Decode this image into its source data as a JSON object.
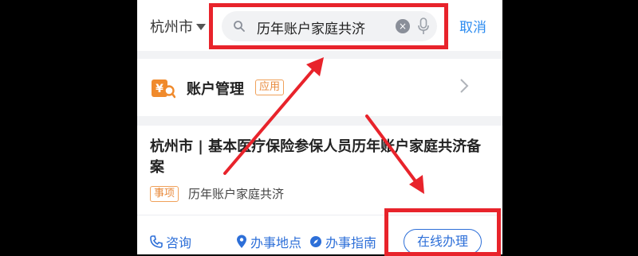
{
  "header": {
    "city": "杭州市",
    "search_query": "历年账户家庭共济",
    "clear_glyph": "×",
    "cancel": "取消"
  },
  "account_card": {
    "title": "账户管理",
    "tag": "应用",
    "icon": "yen-search-icon"
  },
  "item_card": {
    "title": "杭州市 | 基本医疗保险参保人员历年账户家庭共济备案",
    "tag": "事项",
    "name": "历年账户家庭共济",
    "actions": [
      {
        "label": "咨询",
        "icon": "phone-icon"
      },
      {
        "label": "办事地点",
        "icon": "location-icon"
      },
      {
        "label": "办事指南",
        "icon": "compass-icon"
      }
    ],
    "online_button": "在线办理"
  },
  "colors": {
    "accent": "#2d6fd8",
    "annotation_red": "#e8232b",
    "tag_orange": "#e8893a"
  }
}
